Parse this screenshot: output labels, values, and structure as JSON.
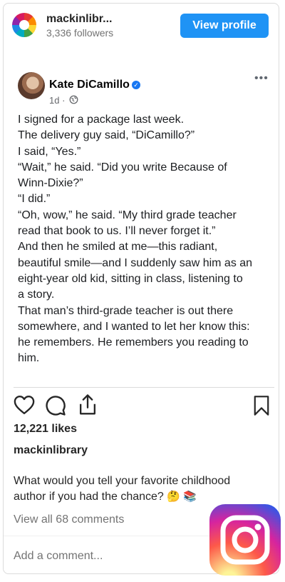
{
  "account": {
    "username": "mackinlibr...",
    "followers": "3,336 followers",
    "view_profile_label": "View profile"
  },
  "embedded_post": {
    "author_name": "Kate DiCamillo",
    "time": "1d ·",
    "more_label": "•••",
    "body_lines": [
      "I signed for a package last week.",
      "The delivery guy said, “DiCamillo?”",
      "I said, “Yes.”",
      "“Wait,” he said.  “Did you write Because of",
      "Winn-Dixie?”",
      "“I did.”",
      "“Oh, wow,” he said. “My third grade teacher",
      "read that book to us.  I’ll never forget it.”",
      "And then he smiled at me—this radiant,",
      "beautiful smile—and I suddenly saw him as an",
      "eight-year old kid, sitting in class, listening to",
      "a story.",
      "That man’s third-grade teacher is out there",
      "somewhere, and I wanted to let her know this:",
      "he remembers.  He remembers you reading to",
      "him."
    ]
  },
  "likes": "12,221 likes",
  "caption": {
    "author": "mackinlibrary",
    "text": "What would you tell your favorite childhood author if you had the chance?",
    "emoji": "🤔 📚"
  },
  "view_comments": "View all 68 comments",
  "add_comment_placeholder": "Add a comment..."
}
